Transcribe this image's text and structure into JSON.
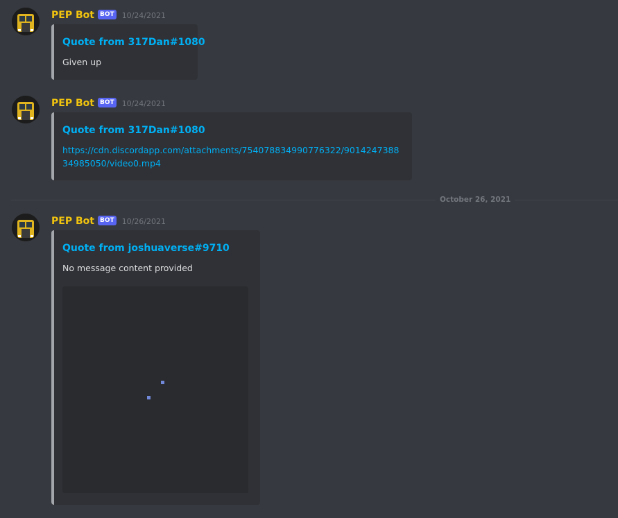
{
  "messages": [
    {
      "author": "PEP Bot",
      "badge": "BOT",
      "timestamp": "10/24/2021",
      "embed": {
        "title": "Quote from 317Dan#1080",
        "description": "Given up"
      }
    },
    {
      "author": "PEP Bot",
      "badge": "BOT",
      "timestamp": "10/24/2021",
      "embed": {
        "title": "Quote from 317Dan#1080",
        "link": "https://cdn.discordapp.com/attachments/754078834990776322/901424738834985050/video0.mp4"
      }
    },
    {
      "author": "PEP Bot",
      "badge": "BOT",
      "timestamp": "10/26/2021",
      "embed": {
        "title": "Quote from joshuaverse#9710",
        "description": "No message content provided"
      }
    }
  ],
  "date_divider": "October 26, 2021",
  "colors": {
    "username": "#f1c40f",
    "bot_badge": "#5865f2",
    "embed_title": "#00b0f4",
    "embed_border": "#a3a6aa",
    "background": "#36393f"
  }
}
